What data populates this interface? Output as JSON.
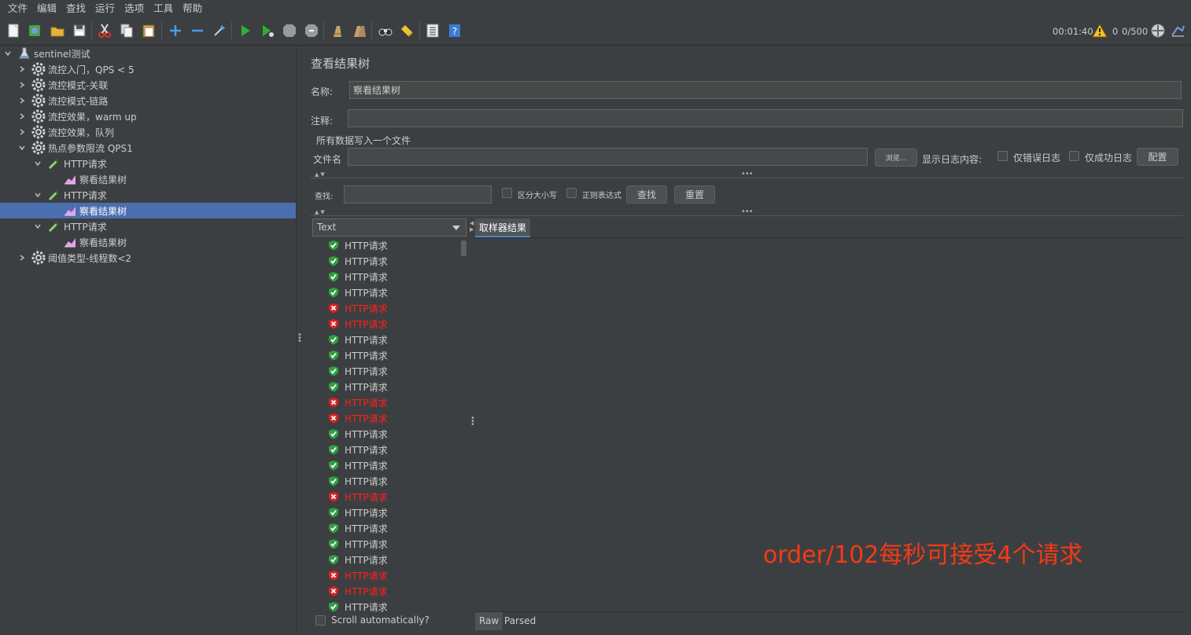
{
  "menu": [
    "文件",
    "编辑",
    "查找",
    "运行",
    "选项",
    "工具",
    "帮助"
  ],
  "toolbar": {
    "icons": [
      "new-icon",
      "templates-icon",
      "open-icon",
      "save-icon",
      "cut-icon",
      "copy-icon",
      "paste-icon",
      "expand-icon",
      "collapse-icon",
      "toggle-icon",
      "start-icon",
      "start-no-pause-icon",
      "stop-icon",
      "shutdown-icon",
      "clear-icon",
      "clear-all-icon",
      "search-icon",
      "reset-search-icon",
      "function-helper-icon",
      "help-icon"
    ],
    "elapsed": "00:01:40",
    "warnings": "0",
    "threads": "0/500"
  },
  "tree": {
    "root": "sentinel测试",
    "nodes": [
      {
        "label": "流控入门，QPS < 5"
      },
      {
        "label": "流控模式-关联"
      },
      {
        "label": "流控模式-链路"
      },
      {
        "label": "流控效果，warm up"
      },
      {
        "label": "流控效果，队列"
      },
      {
        "label": "热点参数限流 QPS1"
      },
      {
        "label": "HTTP请求"
      },
      {
        "label": "察看结果树"
      },
      {
        "label": "HTTP请求"
      },
      {
        "label": "察看结果树"
      },
      {
        "label": "HTTP请求"
      },
      {
        "label": "察看结果树"
      },
      {
        "label": "阈值类型-线程数<2"
      }
    ]
  },
  "panel": {
    "title": "查看结果树",
    "name_label": "名称:",
    "name_value": "察看结果树",
    "comment_label": "注释:",
    "comment_value": "",
    "write_all_label": "所有数据写入一个文件",
    "filename_label": "文件名",
    "filename_value": "",
    "browse_label": "浏览...",
    "log_content_label": "显示日志内容:",
    "errors_only_label": "仅错误日志",
    "success_only_label": "仅成功日志",
    "configure_label": "配置",
    "search_label": "查找:",
    "search_value": "",
    "case_sensitive_label": "区分大小写",
    "regex_label": "正则表达式",
    "find_button": "查找",
    "reset_button": "重置",
    "renderer": "Text",
    "sampler_tab": "取样器结果",
    "overlay_text": "order/102每秒可接受4个请求",
    "raw_tab": "Raw",
    "parsed_tab": "Parsed",
    "scroll_auto_label": "Scroll automatically?"
  },
  "results": [
    {
      "label": "HTTP请求",
      "status": "ok"
    },
    {
      "label": "HTTP请求",
      "status": "ok"
    },
    {
      "label": "HTTP请求",
      "status": "ok"
    },
    {
      "label": "HTTP请求",
      "status": "ok"
    },
    {
      "label": "HTTP请求",
      "status": "err"
    },
    {
      "label": "HTTP请求",
      "status": "err"
    },
    {
      "label": "HTTP请求",
      "status": "ok"
    },
    {
      "label": "HTTP请求",
      "status": "ok"
    },
    {
      "label": "HTTP请求",
      "status": "ok"
    },
    {
      "label": "HTTP请求",
      "status": "ok"
    },
    {
      "label": "HTTP请求",
      "status": "err"
    },
    {
      "label": "HTTP请求",
      "status": "err"
    },
    {
      "label": "HTTP请求",
      "status": "ok"
    },
    {
      "label": "HTTP请求",
      "status": "ok"
    },
    {
      "label": "HTTP请求",
      "status": "ok"
    },
    {
      "label": "HTTP请求",
      "status": "ok"
    },
    {
      "label": "HTTP请求",
      "status": "err"
    },
    {
      "label": "HTTP请求",
      "status": "ok"
    },
    {
      "label": "HTTP请求",
      "status": "ok"
    },
    {
      "label": "HTTP请求",
      "status": "ok"
    },
    {
      "label": "HTTP请求",
      "status": "ok"
    },
    {
      "label": "HTTP请求",
      "status": "err"
    },
    {
      "label": "HTTP请求",
      "status": "err"
    },
    {
      "label": "HTTP请求",
      "status": "ok"
    }
  ],
  "colors": {
    "selection": "#4b6eaf",
    "error_text": "#ff2020",
    "ok_icon": "#2ea043",
    "err_icon": "#e02020",
    "overlay": "#f53a14"
  }
}
